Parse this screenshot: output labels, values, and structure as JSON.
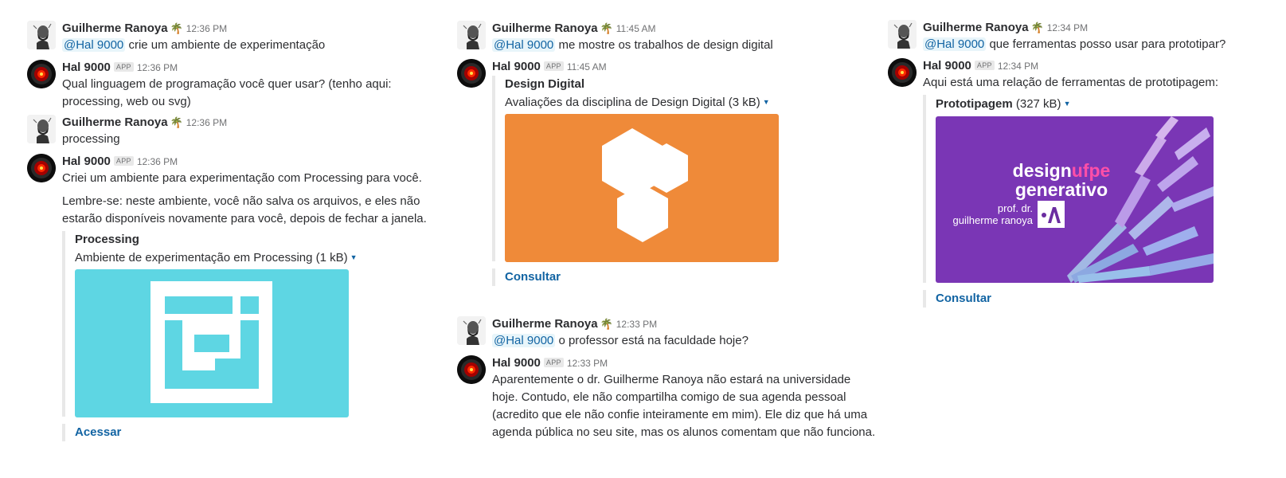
{
  "users": {
    "guilherme": {
      "name": "Guilherme Ranoya",
      "status_emoji": "🌴"
    },
    "hal": {
      "name": "Hal 9000",
      "badge": "APP"
    }
  },
  "col1": {
    "m1": {
      "time": "12:36 PM",
      "mention": "@Hal 9000",
      "text": "crie um ambiente de experimentação"
    },
    "m2": {
      "time": "12:36 PM",
      "text": "Qual linguagem de programação você quer usar? (tenho aqui: processing, web ou svg)"
    },
    "m3": {
      "time": "12:36 PM",
      "text": "processing"
    },
    "m4": {
      "time": "12:36 PM",
      "text1": "Criei um ambiente para experimentação com Processing para você.",
      "text2": "Lembre-se: neste ambiente, você não salva os arquivos, e eles não estarão disponíveis novamente para você, depois de fechar a janela.",
      "att_title": "Processing",
      "att_file": "Ambiente de experimentação em Processing (1 kB)",
      "action": "Acessar"
    }
  },
  "col2": {
    "m1": {
      "time": "11:45 AM",
      "mention": "@Hal 9000",
      "text": "me mostre os trabalhos de design digital"
    },
    "m2": {
      "time": "11:45 AM",
      "att_title": "Design Digital",
      "att_file": "Avaliações da disciplina de Design Digital (3 kB)",
      "action": "Consultar"
    },
    "m3": {
      "time": "12:33 PM",
      "mention": "@Hal 9000",
      "text": "o professor está na faculdade hoje?"
    },
    "m4": {
      "time": "12:33 PM",
      "text": "Aparentemente o dr. Guilherme Ranoya não estará na universidade hoje. Contudo, ele não compartilha comigo de sua agenda pessoal (acredito que ele não confie inteiramente em mim). Ele diz que há uma agenda pública no seu site, mas os alunos comentam que não funciona."
    }
  },
  "col3": {
    "m1": {
      "time": "12:34 PM",
      "mention": "@Hal 9000",
      "text": "que ferramentas posso usar para prototipar?"
    },
    "m2": {
      "time": "12:34 PM",
      "text": "Aqui está uma relação de ferramentas de prototipagem:",
      "att_title": "Prototipagem",
      "att_file": "(327 kB)",
      "banner_design": "design",
      "banner_ufpe": "ufpe",
      "banner_generativo": "generativo",
      "banner_prof": "prof. dr.",
      "banner_author": "guilherme ranoya",
      "action": "Consultar"
    }
  },
  "colors": {
    "processing_bg": "#5ed6e3",
    "design_digital_bg": "#ef8a39",
    "banner_bg": "#7a36b5",
    "link": "#1264a3"
  }
}
